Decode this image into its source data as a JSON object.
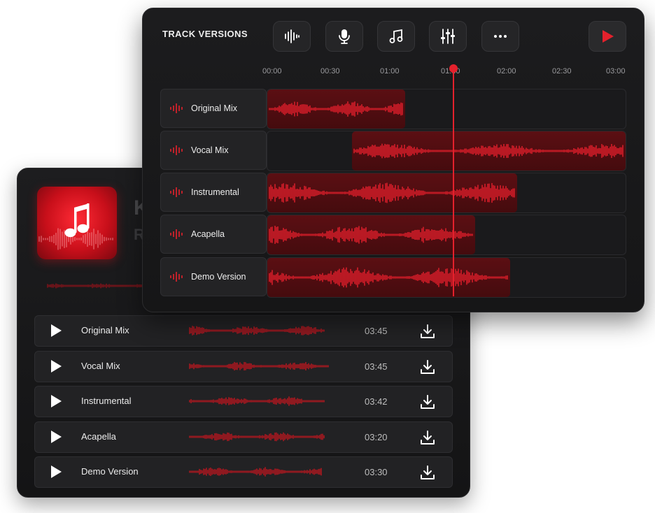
{
  "colors": {
    "accent": "#e4212c",
    "panel": "#1c1c1e",
    "clip": "#4f0d10"
  },
  "player": {
    "album_title": "K",
    "album_subtitle": "R",
    "cover_icon": "music-note-icon",
    "tracks": [
      {
        "title": "Original Mix",
        "duration": "03:45"
      },
      {
        "title": "Vocal Mix",
        "duration": "03:45"
      },
      {
        "title": "Instrumental",
        "duration": "03:42"
      },
      {
        "title": "Acapella",
        "duration": "03:20"
      },
      {
        "title": "Demo Version",
        "duration": "03:30"
      }
    ]
  },
  "editor": {
    "title": "TRACK VERSIONS",
    "tools": [
      "waveform-icon",
      "microphone-icon",
      "music-note-icon",
      "mixer-sliders-icon",
      "more-icon",
      "play-icon"
    ],
    "timeline": [
      "00:00",
      "00:30",
      "01:00",
      "01:30",
      "02:00",
      "02:30",
      "03:00"
    ],
    "playhead_time": "01:30",
    "lanes": [
      {
        "name": "Original Mix",
        "clip_start": "00:00",
        "clip_end": "01:15"
      },
      {
        "name": "Vocal Mix",
        "clip_start": "00:45",
        "clip_end": "03:18"
      },
      {
        "name": "Instrumental",
        "clip_start": "00:00",
        "clip_end": "02:15"
      },
      {
        "name": "Acapella",
        "clip_start": "00:00",
        "clip_end": "01:52"
      },
      {
        "name": "Demo Version",
        "clip_start": "00:00",
        "clip_end": "02:10"
      }
    ]
  }
}
